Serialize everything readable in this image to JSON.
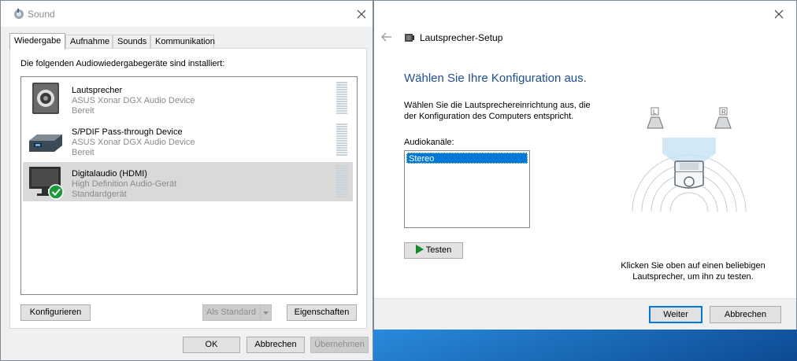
{
  "sound_window": {
    "title": "Sound",
    "tabs": [
      {
        "label": "Wiedergabe",
        "active": true
      },
      {
        "label": "Aufnahme",
        "active": false
      },
      {
        "label": "Sounds",
        "active": false
      },
      {
        "label": "Kommunikation",
        "active": false
      }
    ],
    "heading": "Die folgenden Audiowiedergabegeräte sind installiert:",
    "devices": [
      {
        "name": "Lautsprecher",
        "description": "ASUS Xonar DGX Audio Device",
        "status": "Bereit",
        "icon": "speaker-icon",
        "selected": false,
        "default": false
      },
      {
        "name": "S/PDIF Pass-through Device",
        "description": "ASUS Xonar DGX Audio Device",
        "status": "Bereit",
        "icon": "spdif-device-icon",
        "selected": false,
        "default": false
      },
      {
        "name": "Digitalaudio (HDMI)",
        "description": "High Definition Audio-Gerät",
        "status": "Standardgerät",
        "icon": "monitor-icon",
        "selected": true,
        "default": true
      }
    ],
    "buttons": {
      "configure": "Konfigurieren",
      "set_default": "Als Standard",
      "properties": "Eigenschaften",
      "ok": "OK",
      "cancel": "Abbrechen",
      "apply": "Übernehmen"
    }
  },
  "setup_window": {
    "title": "Lautsprecher-Setup",
    "heading": "Wählen Sie Ihre Konfiguration aus.",
    "description_line1": "Wählen Sie die Lautsprechereinrichtung aus, die",
    "description_line2": "der Konfiguration des Computers entspricht.",
    "channels_label": "Audiokanäle:",
    "channels": [
      "Stereo"
    ],
    "selected_channel": "Stereo",
    "test_button": "Testen",
    "speaker_labels": {
      "left": "L",
      "right": "R"
    },
    "hint_line1": "Klicken Sie oben auf einen beliebigen",
    "hint_line2": "Lautsprecher, um ihn zu testen.",
    "buttons": {
      "next": "Weiter",
      "cancel": "Abbrechen"
    }
  },
  "colors": {
    "accent": "#0078d7",
    "heading_blue": "#1e4e94",
    "check_green": "#1a9b3b",
    "play_green": "#138a2c"
  }
}
